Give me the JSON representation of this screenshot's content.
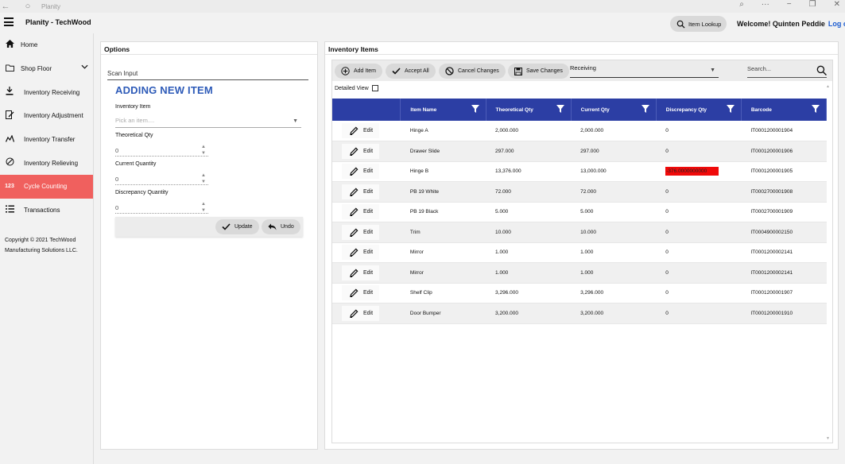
{
  "window": {
    "title": "Planity"
  },
  "header": {
    "app_title": "Planity - TechWood",
    "item_lookup": "Item Lookup",
    "welcome": "Welcome! Quinten Peddie",
    "logout": "Log out"
  },
  "sidebar": {
    "items": [
      {
        "label": "Home",
        "icon": "home-icon"
      },
      {
        "label": "Shop Floor",
        "icon": "shop-floor-icon"
      },
      {
        "label": "Inventory Receiving",
        "icon": "download-icon"
      },
      {
        "label": "Inventory Adjustment",
        "icon": "adjust-icon"
      },
      {
        "label": "Inventory Transfer",
        "icon": "transfer-icon"
      },
      {
        "label": "Inventory Relieving",
        "icon": "relieve-icon"
      },
      {
        "label": "Cycle Counting",
        "icon": "counter-icon",
        "icon_text": "123"
      },
      {
        "label": "Transactions",
        "icon": "list-icon"
      }
    ],
    "copyright": "Copyright © 2021 TechWood Manufacturing Solutions LLC."
  },
  "options": {
    "title": "Options",
    "scan_input": "Scan Input",
    "heading": "ADDING NEW ITEM",
    "inventory_item_label": "Inventory Item",
    "inventory_item_placeholder": "Pick an item....",
    "theoretical_label": "Theoretical Qty",
    "theoretical_value": "0",
    "current_label": "Current Quantity",
    "current_value": "0",
    "discrepancy_label": "Discrepancy Quantity",
    "discrepancy_value": "0",
    "update_label": "Update",
    "undo_label": "Undo"
  },
  "items": {
    "title": "Inventory Items",
    "toolbar": {
      "add": "Add Item",
      "accept": "Accept All",
      "cancel": "Cancel Changes",
      "save": "Save Changes",
      "mode": "Receiving",
      "search_placeholder": "Search..."
    },
    "detailed_view": "Detailed View",
    "columns": [
      "Item Name",
      "Theoretical Qty",
      "Current Qty",
      "Discrepancy Qty",
      "Barcode"
    ],
    "edit_label": "Edit",
    "rows": [
      {
        "name": "Hinge A",
        "theoretical": "2,000.000",
        "current": "2,000.000",
        "discrepancy": "0",
        "barcode": "IT0001200001904"
      },
      {
        "name": "Drawer Slide",
        "theoretical": "297.000",
        "current": "297.000",
        "discrepancy": "0",
        "barcode": "IT0001200001906"
      },
      {
        "name": "Hinge B",
        "theoretical": "13,376.000",
        "current": "13,000.000",
        "discrepancy": "-376.0000000000",
        "barcode": "IT0001200001905",
        "highlight": true
      },
      {
        "name": "PB 19 White",
        "theoretical": "72.000",
        "current": "72.000",
        "discrepancy": "0",
        "barcode": "IT0002700001908"
      },
      {
        "name": "PB 19 Black",
        "theoretical": "5.000",
        "current": "5.000",
        "discrepancy": "0",
        "barcode": "IT0002700001909"
      },
      {
        "name": "Trim",
        "theoretical": "10.000",
        "current": "10.000",
        "discrepancy": "0",
        "barcode": "IT0004900002150"
      },
      {
        "name": "Mirror",
        "theoretical": "1.000",
        "current": "1.000",
        "discrepancy": "0",
        "barcode": "IT0001200002141"
      },
      {
        "name": "Mirror",
        "theoretical": "1.000",
        "current": "1.000",
        "discrepancy": "0",
        "barcode": "IT0001200002141"
      },
      {
        "name": "Shelf Clip",
        "theoretical": "3,296.000",
        "current": "3,296.000",
        "discrepancy": "0",
        "barcode": "IT0001200001907"
      },
      {
        "name": "Door Bumper",
        "theoretical": "3,200.000",
        "current": "3,200.000",
        "discrepancy": "0",
        "barcode": "IT0001200001910"
      }
    ]
  },
  "colors": {
    "accent_active": "#f0605e",
    "header_blue": "#2c3ea4",
    "title_blue": "#2e5bb8",
    "link_blue": "#1a5bd0",
    "discrepancy_red": "#f00a0a"
  }
}
